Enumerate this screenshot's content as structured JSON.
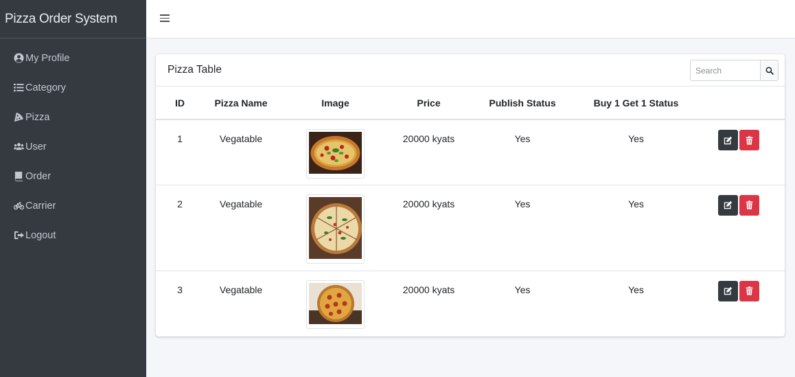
{
  "app": {
    "brand": "Pizza Order System"
  },
  "sidebar": {
    "items": [
      {
        "label": "My Profile",
        "icon": "user-circle-icon"
      },
      {
        "label": "Category",
        "icon": "list-icon"
      },
      {
        "label": "Pizza",
        "icon": "pizza-slice-icon"
      },
      {
        "label": "User",
        "icon": "users-icon"
      },
      {
        "label": "Order",
        "icon": "book-icon"
      },
      {
        "label": "Carrier",
        "icon": "bicycle-icon"
      },
      {
        "label": "Logout",
        "icon": "sign-out-icon"
      }
    ]
  },
  "card": {
    "title": "Pizza Table",
    "search": {
      "placeholder": "Search",
      "value": ""
    }
  },
  "table": {
    "columns": [
      "ID",
      "Pizza Name",
      "Image",
      "Price",
      "Publish Status",
      "Buy 1 Get 1 Status",
      ""
    ],
    "rows": [
      {
        "id": "1",
        "name": "Vegatable",
        "image": "pizza-photo-1",
        "price": "20000 kyats",
        "publish": "Yes",
        "bogo": "Yes"
      },
      {
        "id": "2",
        "name": "Vegatable",
        "image": "pizza-photo-2",
        "price": "20000 kyats",
        "publish": "Yes",
        "bogo": "Yes"
      },
      {
        "id": "3",
        "name": "Vegatable",
        "image": "pizza-photo-3",
        "price": "20000 kyats",
        "publish": "Yes",
        "bogo": "Yes"
      }
    ]
  },
  "colors": {
    "sidebar": "#343a40",
    "edit_button": "#343a40",
    "delete_button": "#dc3545"
  }
}
